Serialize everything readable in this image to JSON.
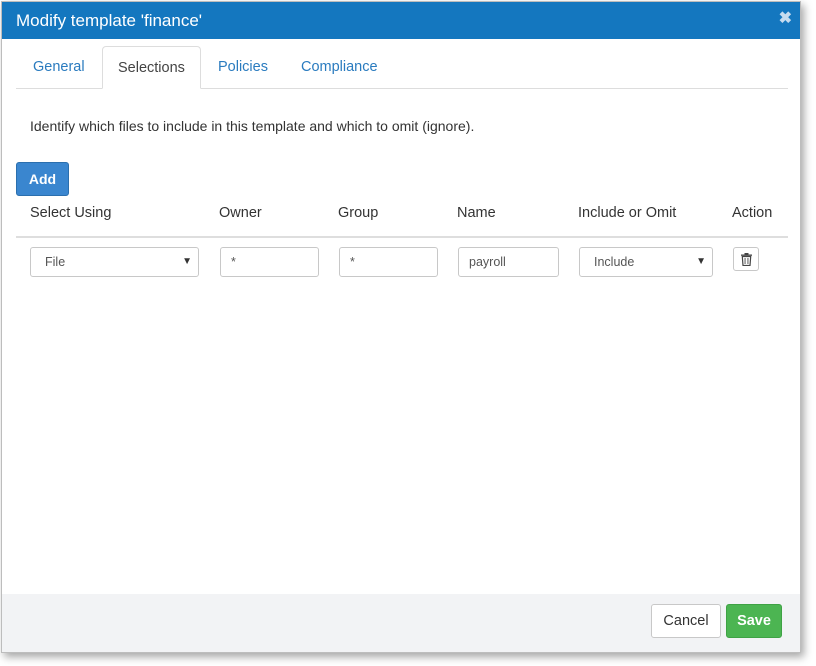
{
  "dialog": {
    "title": "Modify template 'finance'",
    "close_icon": "close-icon",
    "accent_color": "#1477bf"
  },
  "tabs": [
    {
      "label": "General",
      "active": false
    },
    {
      "label": "Selections",
      "active": true
    },
    {
      "label": "Policies",
      "active": false
    },
    {
      "label": "Compliance",
      "active": false
    }
  ],
  "selections": {
    "description": "Identify which files to include in this template and which to omit (ignore).",
    "add_label": "Add",
    "columns": [
      "Select Using",
      "Owner",
      "Group",
      "Name",
      "Include or Omit",
      "Action"
    ],
    "rows": [
      {
        "select_using": "File",
        "owner": "*",
        "group": "*",
        "name": "payroll",
        "include_or_omit": "Include",
        "action_icon": "trash-icon"
      }
    ]
  },
  "footer": {
    "cancel_label": "Cancel",
    "save_label": "Save",
    "save_color": "#4cb552"
  }
}
